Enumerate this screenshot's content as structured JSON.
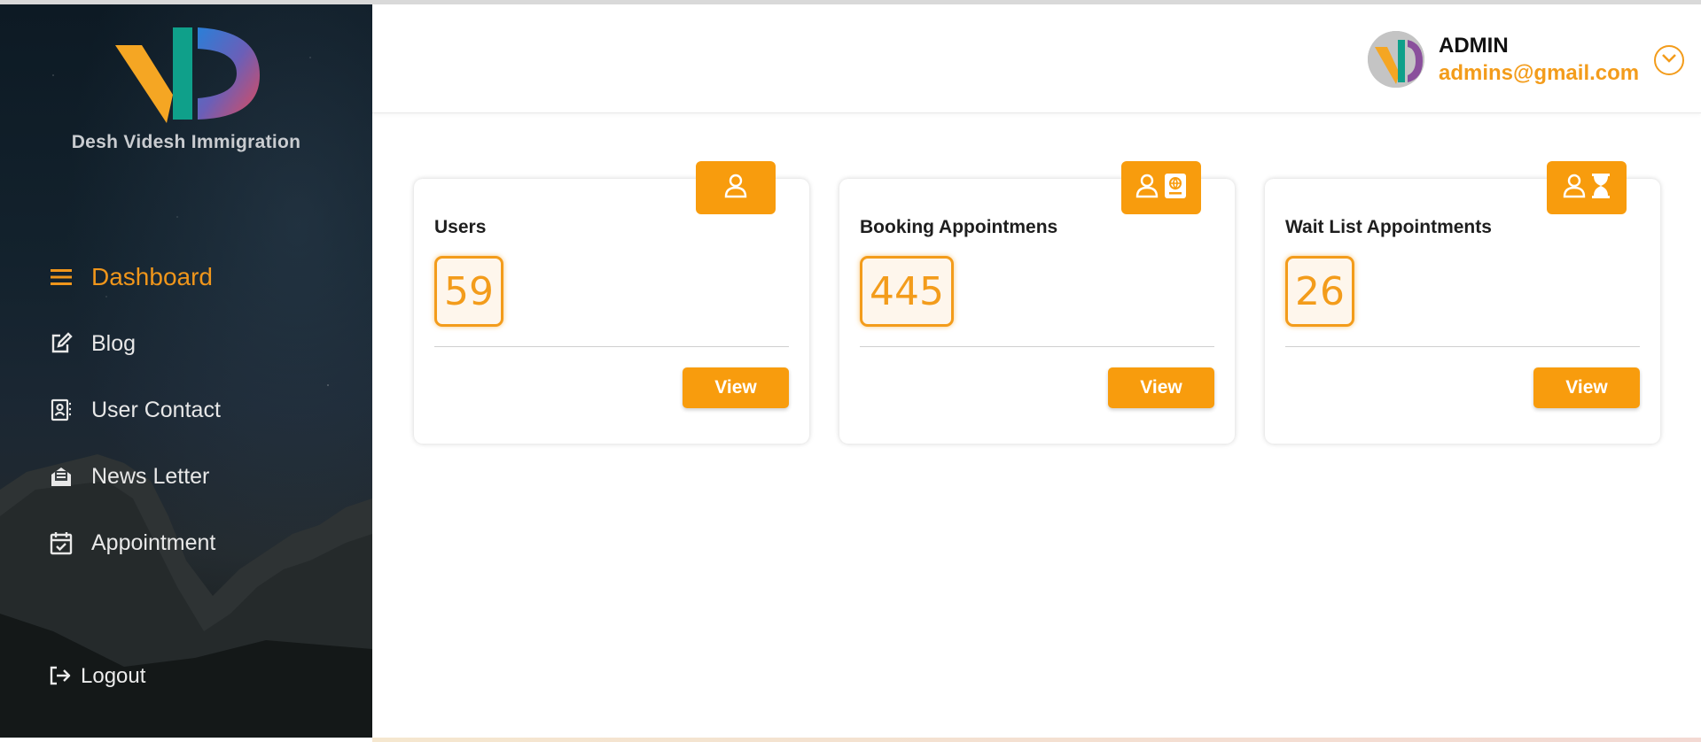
{
  "sidebar": {
    "brand": "Desh Videsh Immigration",
    "items": [
      {
        "label": "Dashboard",
        "icon": "hamburger-icon",
        "active": true
      },
      {
        "label": "Blog",
        "icon": "edit-icon"
      },
      {
        "label": "User Contact",
        "icon": "contact-book-icon"
      },
      {
        "label": "News Letter",
        "icon": "newsletter-icon"
      },
      {
        "label": "Appointment",
        "icon": "calendar-check-icon"
      }
    ],
    "logout": "Logout"
  },
  "header": {
    "name": "ADMIN",
    "email": "admins@gmail.com"
  },
  "cards": [
    {
      "title": "Users",
      "count": "59",
      "button": "View",
      "icons": [
        "user-icon"
      ]
    },
    {
      "title": "Booking Appointmens",
      "count": "445",
      "button": "View",
      "icons": [
        "user-icon",
        "passport-icon"
      ]
    },
    {
      "title": "Wait List Appointments",
      "count": "26",
      "button": "View",
      "icons": [
        "user-icon",
        "hourglass-icon"
      ]
    }
  ],
  "colors": {
    "accent": "#f89c0d",
    "accent_text": "#f39c1b"
  }
}
